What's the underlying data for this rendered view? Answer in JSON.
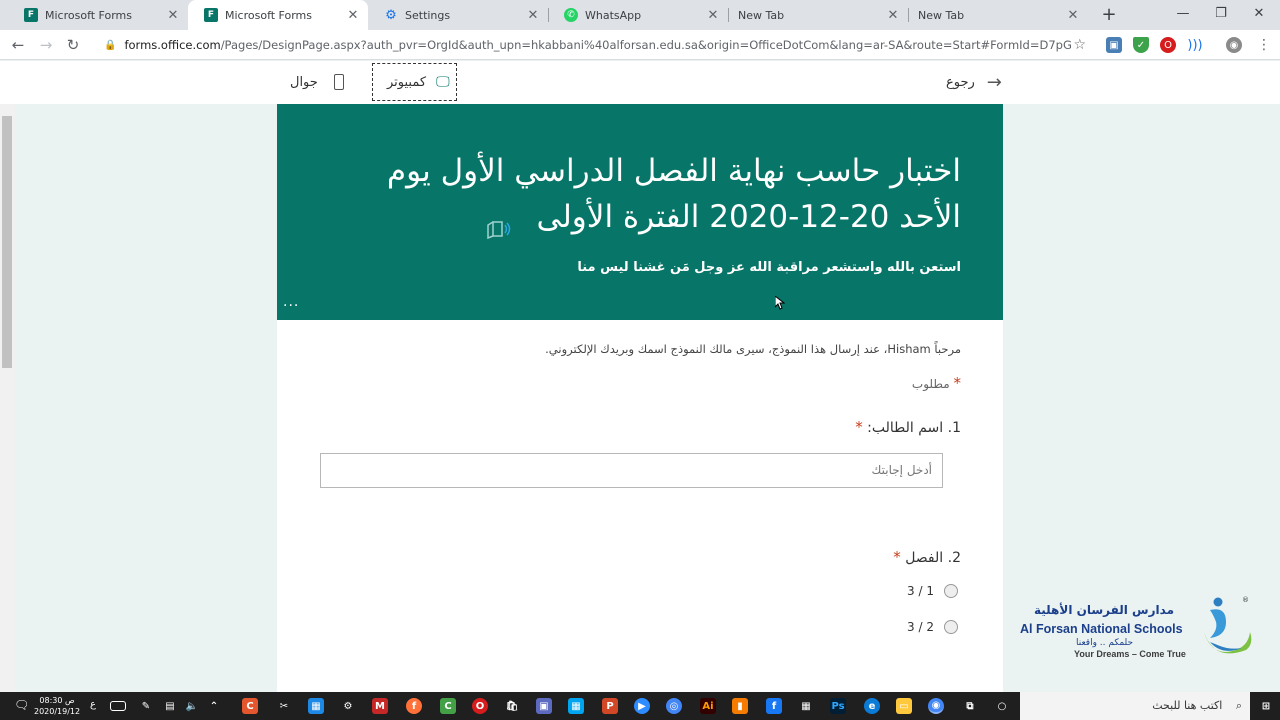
{
  "browser": {
    "tabs": [
      {
        "label": "Microsoft Forms",
        "favicon": "forms-icon"
      },
      {
        "label": "Microsoft Forms",
        "favicon": "forms-icon",
        "active": true
      },
      {
        "label": "Settings",
        "favicon": "gear-icon"
      },
      {
        "label": "WhatsApp",
        "favicon": "whatsapp-icon"
      },
      {
        "label": "New Tab",
        "favicon": "none"
      },
      {
        "label": "New Tab",
        "favicon": "none"
      }
    ],
    "url_domain": "forms.office.com",
    "url_rest": "/Pages/DesignPage.aspx?auth_pvr=OrgId&auth_upn=hkabbani%40alforsan.edu.sa&origin=OfficeDotCom&lang=ar-SA&route=Start#FormId=D7pG11Hx1Ei8rD..."
  },
  "preview": {
    "back_label": "رجوع",
    "computer_label": "كمبيوتر",
    "mobile_label": "جوال"
  },
  "form": {
    "title_line1": "اختبار حاسب نهاية الفصل الدراسي الأول يوم",
    "title_line2": "الأحد 20-12-2020 الفترة الأولى",
    "subtitle": "استعن بالله واستشعر مراقبة الله عز وجل مَن غشنا ليس منا",
    "more": "...",
    "greeting": "مرحباً Hisham، عند إرسال هذا النموذج، سيرى مالك النموذج اسمك وبريدك الإلكتروني.",
    "required_note": "مطلوب",
    "questions": [
      {
        "number": "1.",
        "label": "اسم الطالب:",
        "placeholder": "أدخل إجابتك"
      },
      {
        "number": "2.",
        "label": "الفصل",
        "options": [
          "1 / 3",
          "2 / 3"
        ]
      }
    ],
    "accent": "#077568"
  },
  "logo": {
    "arabic_name": "مدارس الفرسان الأهلية",
    "english_name": "Al Forsan National Schools",
    "arabic_tag": "حلمكم .. واقعنا",
    "tagline": "Your Dreams – Come True"
  },
  "taskbar": {
    "search_placeholder": "اكتب هنا للبحث",
    "time": "08:30 ص",
    "date": "2020/19/12",
    "lang": "ع"
  }
}
